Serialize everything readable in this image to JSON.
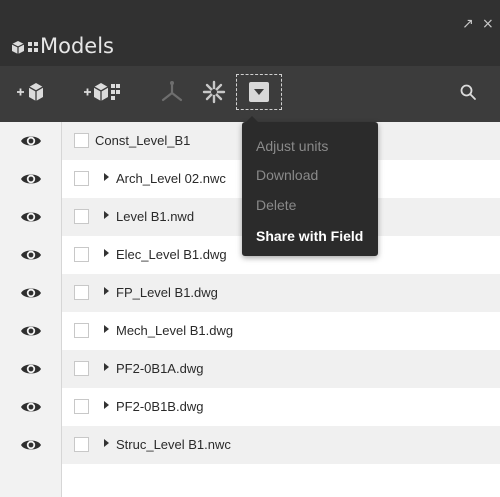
{
  "window": {
    "title": "Models",
    "title_icon": "models-cubes-icon",
    "popout_glyph": "↗",
    "close_glyph": "×"
  },
  "toolbar": {
    "buttons": [
      {
        "name": "add-model-icon"
      },
      {
        "name": "add-models-group-icon"
      },
      {
        "name": "hierarchy-icon"
      },
      {
        "name": "asterisk-sparkle-icon"
      },
      {
        "name": "more-options-dropdown-icon"
      },
      {
        "name": "search-icon"
      }
    ]
  },
  "menu": {
    "items": [
      {
        "label": "Adjust units",
        "enabled": false
      },
      {
        "label": "Download",
        "enabled": false
      },
      {
        "label": "Delete",
        "enabled": false
      },
      {
        "label": "Share with Field",
        "enabled": true
      }
    ]
  },
  "models": [
    {
      "label": "Const_Level_B1",
      "expandable": false
    },
    {
      "label": "Arch_Level 02.nwc",
      "expandable": true
    },
    {
      "label": "Level B1.nwd",
      "expandable": true
    },
    {
      "label": "Elec_Level B1.dwg",
      "expandable": true
    },
    {
      "label": "FP_Level B1.dwg",
      "expandable": true
    },
    {
      "label": "Mech_Level B1.dwg",
      "expandable": true
    },
    {
      "label": "PF2-0B1A.dwg",
      "expandable": true
    },
    {
      "label": "PF2-0B1B.dwg",
      "expandable": true
    },
    {
      "label": "Struc_Level B1.nwc",
      "expandable": true
    }
  ],
  "colors": {
    "titlebar": "#313131",
    "toolbar": "#3c3c3c",
    "menu_bg": "#2b2b2b",
    "row_alt": "#f0f0f0"
  }
}
